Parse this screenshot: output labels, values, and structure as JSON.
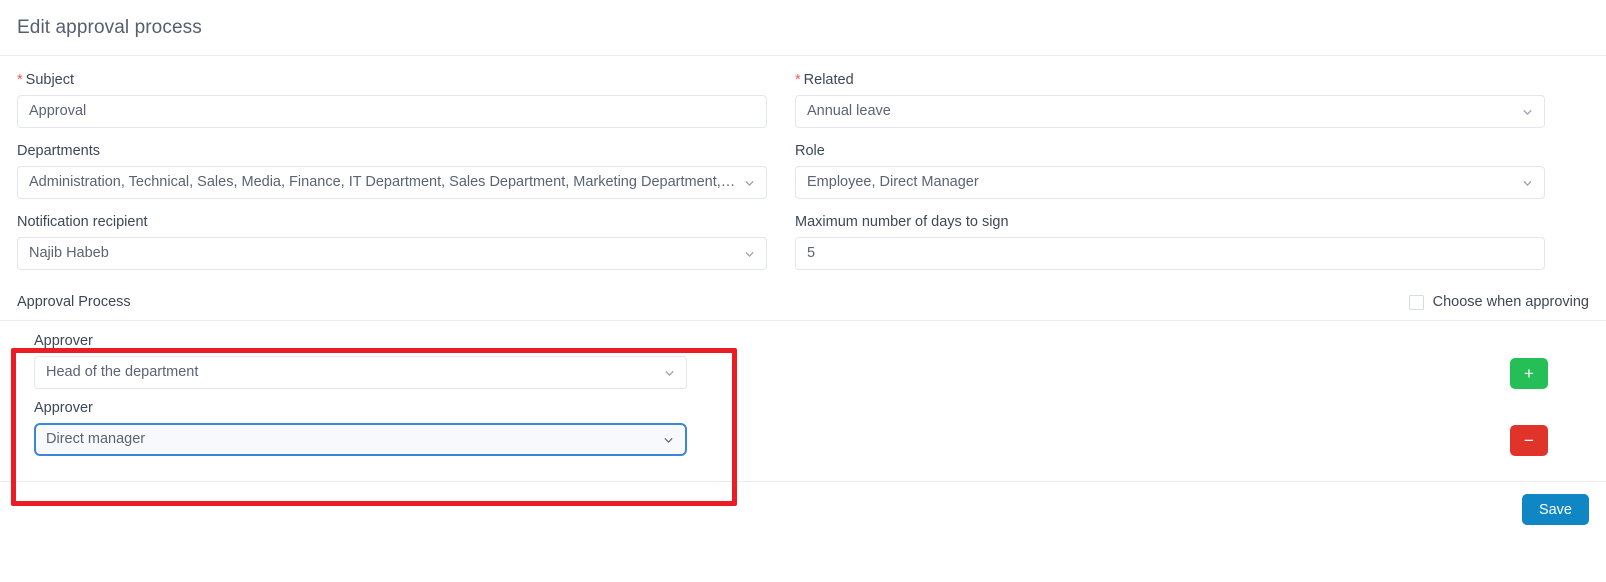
{
  "header": {
    "title": "Edit approval process"
  },
  "form": {
    "subject": {
      "label": "Subject",
      "required_mark": "*",
      "value": "Approval"
    },
    "related": {
      "label": "Related",
      "required_mark": "*",
      "value": "Annual leave",
      "icon": "chevron-down-icon"
    },
    "departments": {
      "label": "Departments",
      "value": "Administration, Technical, Sales, Media, Finance, IT Department, Sales Department, Marketing Department, Fina...",
      "icon": "chevron-down-icon"
    },
    "role": {
      "label": "Role",
      "value": "Employee, Direct Manager",
      "icon": "chevron-down-icon"
    },
    "notification_recipient": {
      "label": "Notification recipient",
      "value": "Najib Habeb",
      "icon": "chevron-down-icon"
    },
    "max_days": {
      "label": "Maximum number of days to sign",
      "value": "5"
    }
  },
  "approval_process": {
    "section_title": "Approval Process",
    "choose_when_approving": {
      "label": "Choose when approving",
      "checked": false
    },
    "approvers": [
      {
        "label": "Approver",
        "value": "Head of the department",
        "icon": "chevron-down-icon",
        "focused": false,
        "action_label": "+",
        "action_name": "add-approver-button"
      },
      {
        "label": "Approver",
        "value": "Direct manager",
        "icon": "chevron-down-icon",
        "focused": true,
        "action_label": "−",
        "action_name": "remove-approver-button"
      }
    ]
  },
  "footer": {
    "save_label": "Save"
  },
  "colors": {
    "accent_blue": "#1086c5",
    "add_green": "#26bf57",
    "remove_red": "#e0342b",
    "highlight_red": "#ec1c24",
    "required_red": "#f15b5b",
    "focus_blue": "#3c86d8"
  }
}
